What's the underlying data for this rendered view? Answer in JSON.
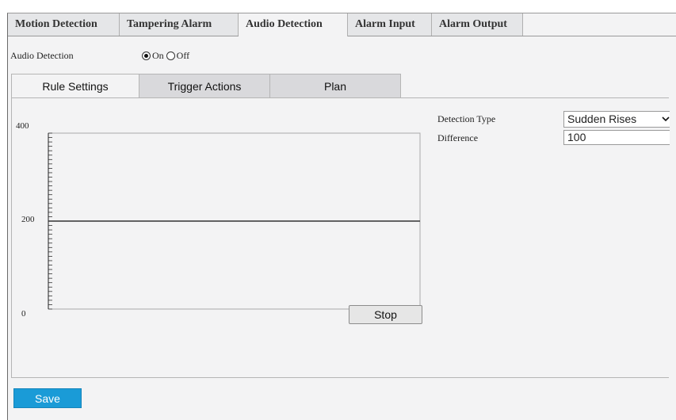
{
  "main_tabs": [
    {
      "label": "Motion Detection",
      "active": false
    },
    {
      "label": "Tampering Alarm",
      "active": false
    },
    {
      "label": "Audio Detection",
      "active": true
    },
    {
      "label": "Alarm Input",
      "active": false
    },
    {
      "label": "Alarm Output",
      "active": false
    }
  ],
  "audio_detection": {
    "label": "Audio Detection",
    "options": [
      "On",
      "Off"
    ],
    "selected": "On"
  },
  "sub_tabs": [
    {
      "label": "Rule Settings",
      "active": true
    },
    {
      "label": "Trigger Actions",
      "active": false
    },
    {
      "label": "Plan",
      "active": false
    }
  ],
  "level_meter": {
    "y_max_label": "400",
    "y_mid_label": "200",
    "y_min_label": "0",
    "y_max": 400,
    "threshold": 200,
    "stop_label": "Stop"
  },
  "detection_type": {
    "label": "Detection Type",
    "value": "Sudden Rises"
  },
  "difference": {
    "label": "Difference",
    "value": "100"
  },
  "save_label": "Save",
  "colors": {
    "accent": "#1a9bd7",
    "background": "#f3f3f4"
  }
}
